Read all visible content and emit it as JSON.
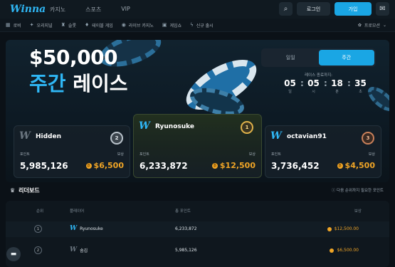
{
  "header": {
    "logo": "Winna",
    "nav": [
      "카지노",
      "스포츠",
      "VIP"
    ],
    "login_label": "로그인",
    "join_label": "가입"
  },
  "categories": [
    {
      "icon": "grid-icon",
      "label": "로비"
    },
    {
      "icon": "star-icon",
      "label": "오리지널"
    },
    {
      "icon": "slot-icon",
      "label": "슬롯"
    },
    {
      "icon": "cards-icon",
      "label": "테이블 게임"
    },
    {
      "icon": "live-icon",
      "label": "라이브 카지노"
    },
    {
      "icon": "gameshow-icon",
      "label": "게임쇼"
    },
    {
      "icon": "bolt-icon",
      "label": "신규 출시"
    }
  ],
  "promo_label": "프로모션",
  "hero": {
    "amount": "$50,000",
    "title_accent": "주간",
    "title_rest": "레이스",
    "tabs": [
      "일일",
      "주간"
    ],
    "active_tab": "주간",
    "ends_label": "레이스 종료까지:",
    "countdown": [
      {
        "value": "05",
        "unit": "일"
      },
      {
        "value": "05",
        "unit": "시"
      },
      {
        "value": "18",
        "unit": "분"
      },
      {
        "value": "35",
        "unit": "초"
      }
    ]
  },
  "podium": [
    {
      "rank": "2",
      "name": "Hidden",
      "points_label": "포인트",
      "points": "5,985,126",
      "prize_label": "보상",
      "prize": "$6,500"
    },
    {
      "rank": "1",
      "name": "Ryunosuke",
      "points_label": "포인트",
      "points": "6,233,872",
      "prize_label": "보상",
      "prize": "$12,500"
    },
    {
      "rank": "3",
      "name": "octavian91",
      "points_label": "포인트",
      "points": "3,736,452",
      "prize_label": "보상",
      "prize": "$4,500"
    }
  ],
  "leaderboard": {
    "title": "리더보드",
    "note": "다음 순위까지 필요한 포인트",
    "columns": [
      "순위",
      "플레이어",
      "총 포인트",
      "보상"
    ],
    "rows": [
      {
        "rank": "1",
        "player": "Ryunosuke",
        "points": "6,233,872",
        "prize": "$12,500.00"
      },
      {
        "rank": "2",
        "player": "숨김",
        "points": "5,985,126",
        "prize": "$6,500.00"
      }
    ]
  },
  "colors": {
    "accent": "#1aa6e4",
    "gold": "#f0a526",
    "background": "#0b1117"
  }
}
